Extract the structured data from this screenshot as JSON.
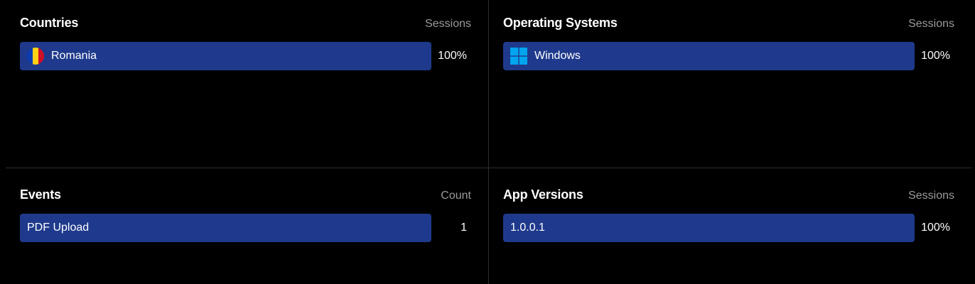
{
  "colors": {
    "background": "#000000",
    "bar": "#1f3a8c",
    "divider": "#2e2e2e",
    "metric_label": "#9a9a9a"
  },
  "countries": {
    "title": "Countries",
    "metric": "Sessions",
    "rows": [
      {
        "label": "Romania",
        "value": "100%",
        "icon": "romania-flag-icon"
      }
    ]
  },
  "operating_systems": {
    "title": "Operating Systems",
    "metric": "Sessions",
    "rows": [
      {
        "label": "Windows",
        "value": "100%",
        "icon": "windows-logo-icon"
      }
    ]
  },
  "events": {
    "title": "Events",
    "metric": "Count",
    "rows": [
      {
        "label": "PDF Upload",
        "value": "1"
      }
    ]
  },
  "app_versions": {
    "title": "App Versions",
    "metric": "Sessions",
    "rows": [
      {
        "label": "1.0.0.1",
        "value": "100%"
      }
    ]
  }
}
